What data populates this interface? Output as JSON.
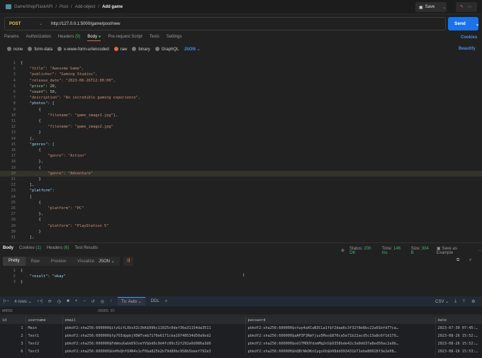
{
  "breadcrumb": [
    "GameShopFlaskAPI",
    "Post",
    "Add-object",
    "Add game"
  ],
  "save_label": "Save",
  "request": {
    "method": "POST",
    "url": "http://127.0.0.1:5000/game/post/new",
    "send_label": "Send"
  },
  "tabs": {
    "params": "Params",
    "authorization": "Authorization",
    "headers": "Headers",
    "headers_count": "(9)",
    "body": "Body",
    "prerequest": "Pre-request Script",
    "tests": "Tests",
    "settings": "Settings",
    "cookies": "Cookies"
  },
  "body_types": {
    "none": "none",
    "form_data": "form-data",
    "urlencoded": "x-www-form-urlencoded",
    "raw": "raw",
    "binary": "binary",
    "graphql": "GraphQL",
    "format": "JSON",
    "beautify": "Beautify"
  },
  "code_lines": [
    "{",
    "    \"title\": \"Awesome Game\",",
    "    \"publisher\": \"Gaming Studios\",",
    "    \"release_date\": \"2023-08-26T12:00:00\",",
    "    \"price\": 20,",
    "    \"count\": 50,",
    "    \"description\": \"An incredible gaming experience\",",
    "    \"photos\": [",
    "        {",
    "            \"filename\": \"game_image1.jpg\"},",
    "        {",
    "            \"filename\": \"game_image2.jpg\"",
    "        }",
    "    ],",
    "    \"genres\": [",
    "        {",
    "            \"genre\": \"Action\"",
    "        },",
    "        {",
    "            \"genre\": \"Adventure\"",
    "        }",
    "    ],",
    "    \"platform\":",
    "    [",
    "        {",
    "            \"platform\": \"PC\"",
    "        },",
    "        {",
    "            \"platform\": \"PlayStation 5\"",
    "        }",
    "    ],"
  ],
  "response": {
    "tabs": {
      "body": "Body",
      "cookies": "Cookies",
      "cookies_count": "(1)",
      "headers": "Headers",
      "headers_count": "(6)",
      "tests": "Test Results"
    },
    "status_label": "Status:",
    "status": "200 OK",
    "time_label": "Time:",
    "time": "146 ms",
    "size_label": "Size:",
    "size": "304 B",
    "save_example": "Save as Example",
    "views": [
      "Pretty",
      "Raw",
      "Preview",
      "Visualize"
    ],
    "format": "JSON",
    "lines": [
      "{",
      "    \"result\": \"okay\"",
      "}"
    ]
  },
  "db": {
    "rows_label": "4 rows",
    "tx": "Tx: Auto",
    "ddl": "DDL",
    "export": "CSV",
    "where": "WHERE",
    "order_by": "ORDER BY",
    "columns": [
      "id",
      "username",
      "email",
      "password",
      "date"
    ],
    "rows": [
      [
        "1",
        "Main",
        "pbkdf2:sha256:600000$itzGifLXbsXZc3kK$996c11025c0def36a31154da3511",
        "pbkdf2:sha256:600000$stwy4aXCuN3CLa1f$f2daa6c3f32f8e8bc22a01bfd77ca…",
        "2023-07-30 07:45:00"
      ],
      [
        "2",
        "Test1",
        "pbkdf2:sha256:600000$fp7OIdppbjVDWTsm$7170e6171cba10748534d50a9od2",
        "pbkdf2:sha256:600000$aAP3F3RmYjuu5Mxo$870ca5e71b22acd5c13a8c6f1d179…",
        "2023-08-26 15:52:18"
      ],
      [
        "3",
        "Test2",
        "pbkdf2:sha256:600000$FeWouXabkD9JseYV$bd0c9d4fc00c32f292a0d986a3d0",
        "pbkdf2:sha256:600000$od1TMOUYdxmMq2nS$9358bde42c3a0dd37a8ed50ac2a9b…",
        "2023-08-26 15:52:32"
      ],
      [
        "6",
        "Test3",
        "pbkdf2:sha256:600000$UnMoQhfQ4N4s1cF0$a825b2b79d80bc958b5beef792e3",
        "pbkdf2:sha256:600000$hQBtNkDKnIygsXb$b08dd993431b71ebe80028f3e2e08…",
        "2023-08-26 15:53:19"
      ]
    ]
  }
}
